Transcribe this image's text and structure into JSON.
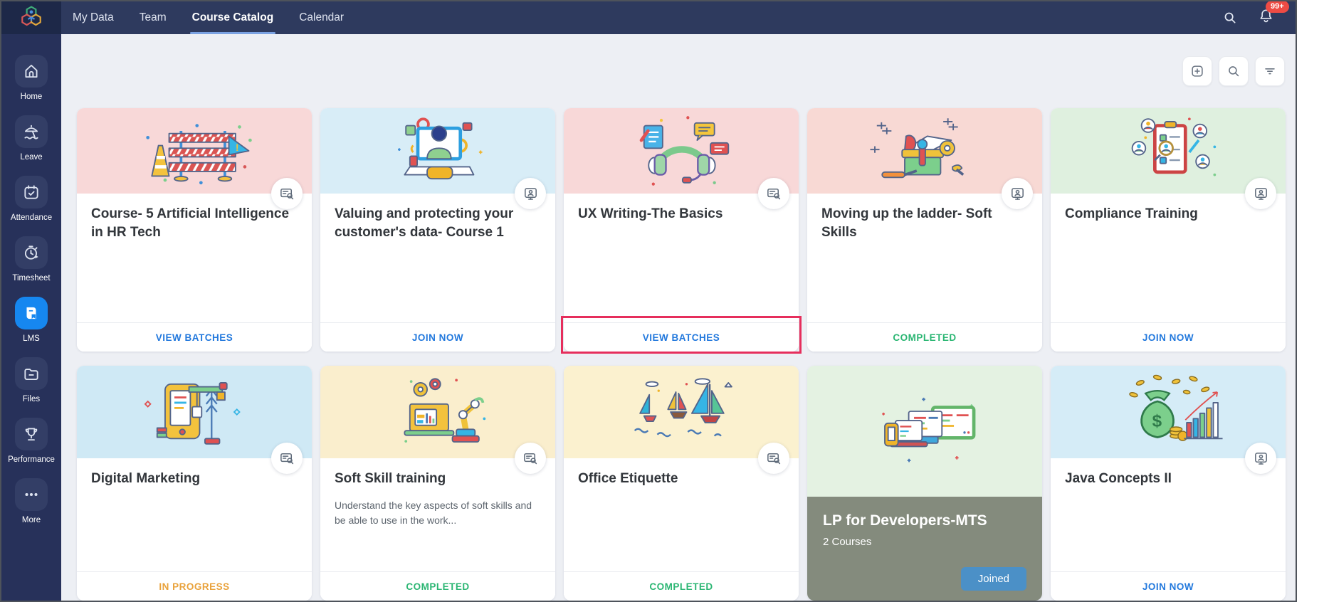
{
  "topbar": {
    "tabs": [
      {
        "label": "My Data",
        "active": false
      },
      {
        "label": "Team",
        "active": false
      },
      {
        "label": "Course Catalog",
        "active": true
      },
      {
        "label": "Calendar",
        "active": false
      }
    ],
    "notification_count": "99+"
  },
  "sidebar": {
    "items": [
      {
        "label": "Home",
        "icon": "home-icon",
        "active": false
      },
      {
        "label": "Leave",
        "icon": "leave-umbrella-icon",
        "active": false
      },
      {
        "label": "Attendance",
        "icon": "attendance-calendar-icon",
        "active": false
      },
      {
        "label": "Timesheet",
        "icon": "timesheet-stopwatch-icon",
        "active": false
      },
      {
        "label": "LMS",
        "icon": "lms-book-icon",
        "active": true
      },
      {
        "label": "Files",
        "icon": "files-folder-icon",
        "active": false
      },
      {
        "label": "Performance",
        "icon": "performance-trophy-icon",
        "active": false
      },
      {
        "label": "More",
        "icon": "more-ellipsis-icon",
        "active": false
      }
    ]
  },
  "toolbar": {
    "buttons": [
      {
        "icon": "add-course-icon"
      },
      {
        "icon": "search-icon"
      },
      {
        "icon": "filter-icon"
      }
    ]
  },
  "cards": [
    {
      "type": "course",
      "title": "Course- 5 Artificial Intelligence in HR Tech",
      "header_bg": "#f8d8d8",
      "illustration": "construction-barrier",
      "badge": "self-paced",
      "action": {
        "label": "VIEW BATCHES",
        "color": "#2379dd",
        "kind": "link"
      },
      "highlighted": false
    },
    {
      "type": "course",
      "title": "Valuing and protecting your customer's data- Course 1",
      "header_bg": "#d8edf7",
      "illustration": "person-computer",
      "badge": "instructor-led",
      "action": {
        "label": "JOIN NOW",
        "color": "#2379dd",
        "kind": "link"
      },
      "highlighted": false
    },
    {
      "type": "course",
      "title": "UX Writing-The Basics",
      "header_bg": "#f8d8d8",
      "illustration": "headphones-chat",
      "badge": "self-paced",
      "action": {
        "label": "VIEW BATCHES",
        "color": "#2379dd",
        "kind": "link"
      },
      "highlighted": true
    },
    {
      "type": "course",
      "title": "Moving up the ladder- Soft Skills",
      "header_bg": "#f8d9d4",
      "illustration": "toolbox",
      "badge": "instructor-led",
      "action": {
        "label": "COMPLETED",
        "color": "#2bb673",
        "kind": "status"
      },
      "highlighted": false
    },
    {
      "type": "course",
      "title": "Compliance Training",
      "header_bg": "#dff0df",
      "illustration": "clipboard-people",
      "badge": "instructor-led",
      "action": {
        "label": "JOIN NOW",
        "color": "#2379dd",
        "kind": "link"
      },
      "highlighted": false
    },
    {
      "type": "course",
      "title": "Digital Marketing",
      "header_bg": "#cfe9f5",
      "illustration": "crane-builder",
      "badge": "self-paced",
      "action": {
        "label": "IN PROGRESS",
        "color": "#e9a23b",
        "kind": "status"
      },
      "highlighted": false
    },
    {
      "type": "course",
      "title": "Soft Skill training",
      "description": "Understand the key aspects of soft skills and be able to use in the work...",
      "header_bg": "#faeecd",
      "illustration": "robot-arm",
      "badge": "self-paced",
      "action": {
        "label": "COMPLETED",
        "color": "#2bb673",
        "kind": "status"
      },
      "highlighted": false
    },
    {
      "type": "course",
      "title": "Office Etiquette",
      "header_bg": "#fbf1cf",
      "illustration": "sailboats",
      "badge": "self-paced",
      "action": {
        "label": "COMPLETED",
        "color": "#2bb673",
        "kind": "status"
      },
      "highlighted": false
    },
    {
      "type": "learning-path",
      "title": "LP for Developers-MTS",
      "courses_count": "2 Courses",
      "button_label": "Joined",
      "header_bg": "#e4f2e2",
      "illustration": "devices",
      "overlay_bg": "#848b7d",
      "button_bg": "#4b90c7"
    },
    {
      "type": "course",
      "title": "Java Concepts II",
      "header_bg": "#d5ecf7",
      "illustration": "money-chart",
      "badge": "instructor-led",
      "action": {
        "label": "JOIN NOW",
        "color": "#2379dd",
        "kind": "link"
      },
      "highlighted": false
    }
  ],
  "colors": {
    "topbar_bg": "#2e3a5e",
    "sidebar_bg": "#27315a",
    "active_tile": "#1687f0",
    "content_bg": "#edeff4",
    "annotation_highlight": "#e62e5c",
    "link_blue": "#2379dd",
    "completed_green": "#2bb673",
    "in_progress_orange": "#e9a23b",
    "notification_red": "#ee4b44"
  }
}
